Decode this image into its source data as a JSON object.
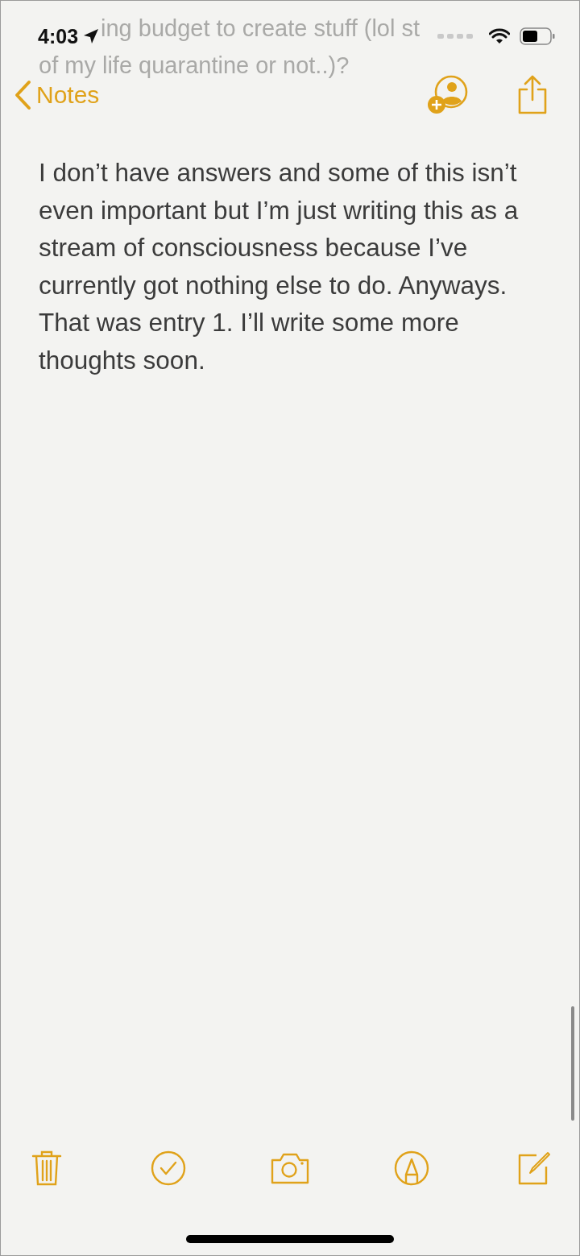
{
  "status_bar": {
    "time": "4:03"
  },
  "scrolled_text": [
    "ing budget to create stuff (lol st",
    "of my life quarantine or not..)?"
  ],
  "nav": {
    "back_label": "Notes"
  },
  "note": {
    "body": "I don’t have answers and some of this isn’t even important but I’m just writing this as a stream of consciousness because I’ve currently got nothing else to do. Anyways. That was entry 1. I’ll write some more thoughts soon."
  },
  "toolbar": [
    {
      "kind": "trash"
    },
    {
      "kind": "checklist"
    },
    {
      "kind": "camera"
    },
    {
      "kind": "markup"
    },
    {
      "kind": "compose"
    }
  ]
}
